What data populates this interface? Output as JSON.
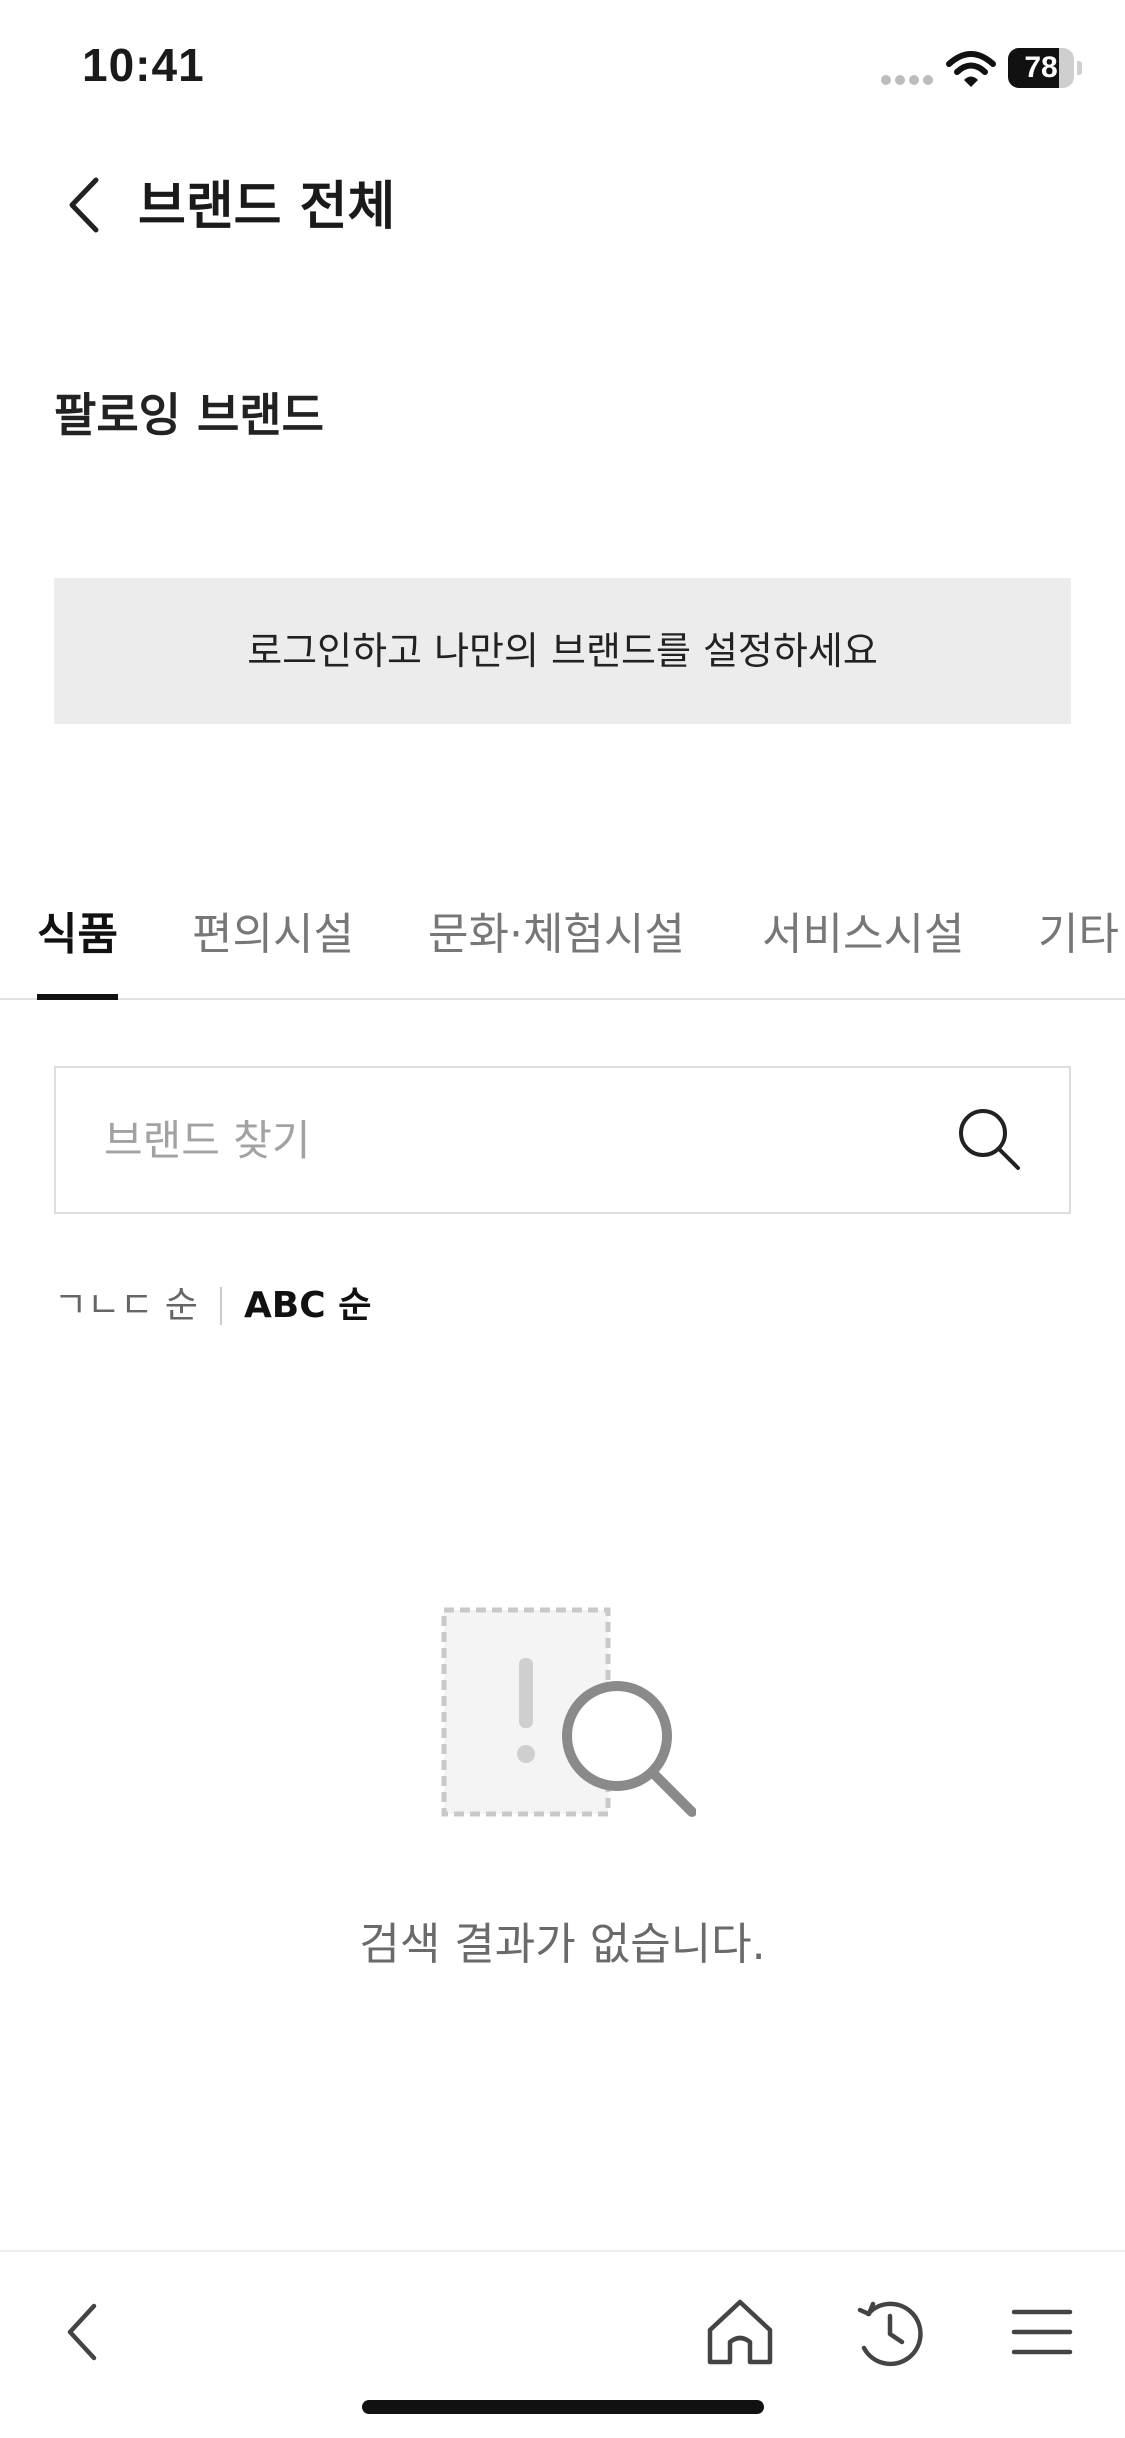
{
  "status_bar": {
    "time": "10:41",
    "battery": "78",
    "battery_level": 0.78
  },
  "header": {
    "back_icon": "chevron-left-icon",
    "title": "브랜드 전체"
  },
  "following": {
    "title": "팔로잉 브랜드",
    "login_prompt": "로그인하고 나만의 브랜드를 설정하세요"
  },
  "tabs": [
    {
      "label": "식품",
      "active": true
    },
    {
      "label": "편의시설",
      "active": false
    },
    {
      "label": "문화·체험시설",
      "active": false
    },
    {
      "label": "서비스시설",
      "active": false
    },
    {
      "label": "기타",
      "active": false
    }
  ],
  "search": {
    "placeholder": "브랜드 찾기",
    "value": "",
    "icon": "search-icon"
  },
  "sort": {
    "options": [
      {
        "label": "ㄱㄴㄷ 순",
        "active": false
      },
      {
        "label": "ABC 순",
        "active": true
      }
    ]
  },
  "empty_state": {
    "icon": "empty-search-icon",
    "message": "검색 결과가 없습니다."
  },
  "bottom_nav": {
    "items": [
      "chevron-left-icon",
      "home-icon",
      "history-icon",
      "menu-icon"
    ]
  },
  "colors": {
    "text_primary": "#111111",
    "text_secondary": "#777777",
    "banner_bg": "#ececec",
    "border": "#dddddd",
    "illustration_gray": "#8a8a8a"
  }
}
